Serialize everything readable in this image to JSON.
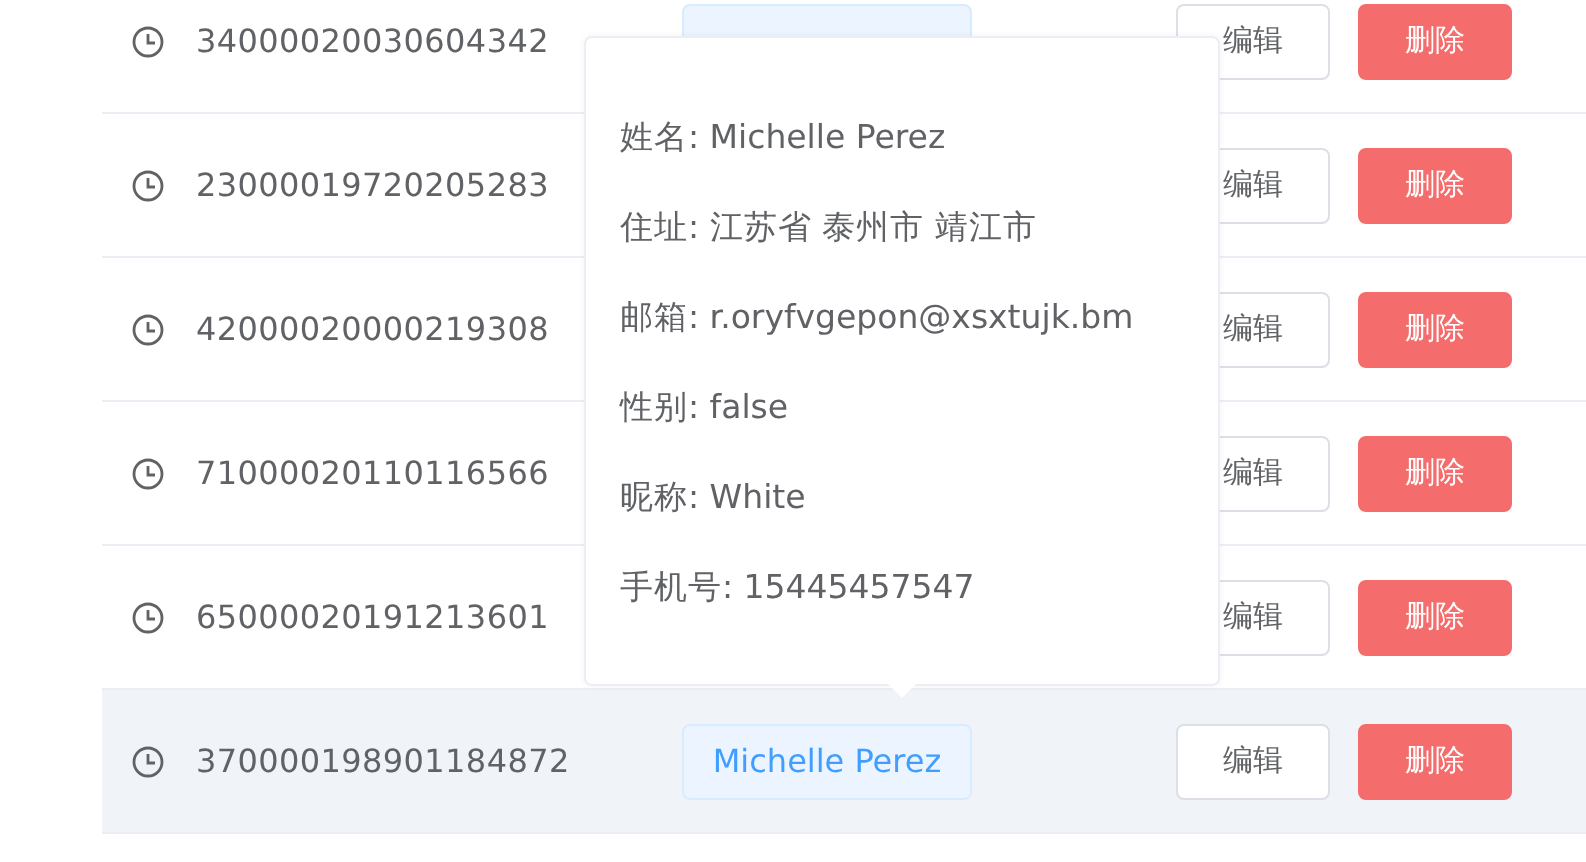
{
  "rows": [
    {
      "id": "34000020030604342",
      "tag_covered": true,
      "edit": "编辑",
      "delete": "删除",
      "hovered": false
    },
    {
      "id": "23000019720205283",
      "edit": "编辑",
      "delete": "删除",
      "hovered": false
    },
    {
      "id": "42000020000219308",
      "edit": "编辑",
      "delete": "删除",
      "hovered": false
    },
    {
      "id": "71000020110116566",
      "edit": "编辑",
      "delete": "删除",
      "hovered": false
    },
    {
      "id": "65000020191213601",
      "edit": "编辑",
      "delete": "删除",
      "hovered": false
    },
    {
      "id": "370000198901184872",
      "tag": "Michelle Perez",
      "edit": "编辑",
      "delete": "删除",
      "hovered": true
    }
  ],
  "popover": {
    "lines": [
      {
        "text": "姓名: Michelle Perez"
      },
      {
        "text": "住址: 江苏省 泰州市 靖江市"
      },
      {
        "text": "邮箱: r.oryfvgepon@xsxtujk.bm"
      },
      {
        "text": "性别: false"
      },
      {
        "text": "昵称: White"
      },
      {
        "text": "手机号: 15445457547"
      }
    ]
  }
}
